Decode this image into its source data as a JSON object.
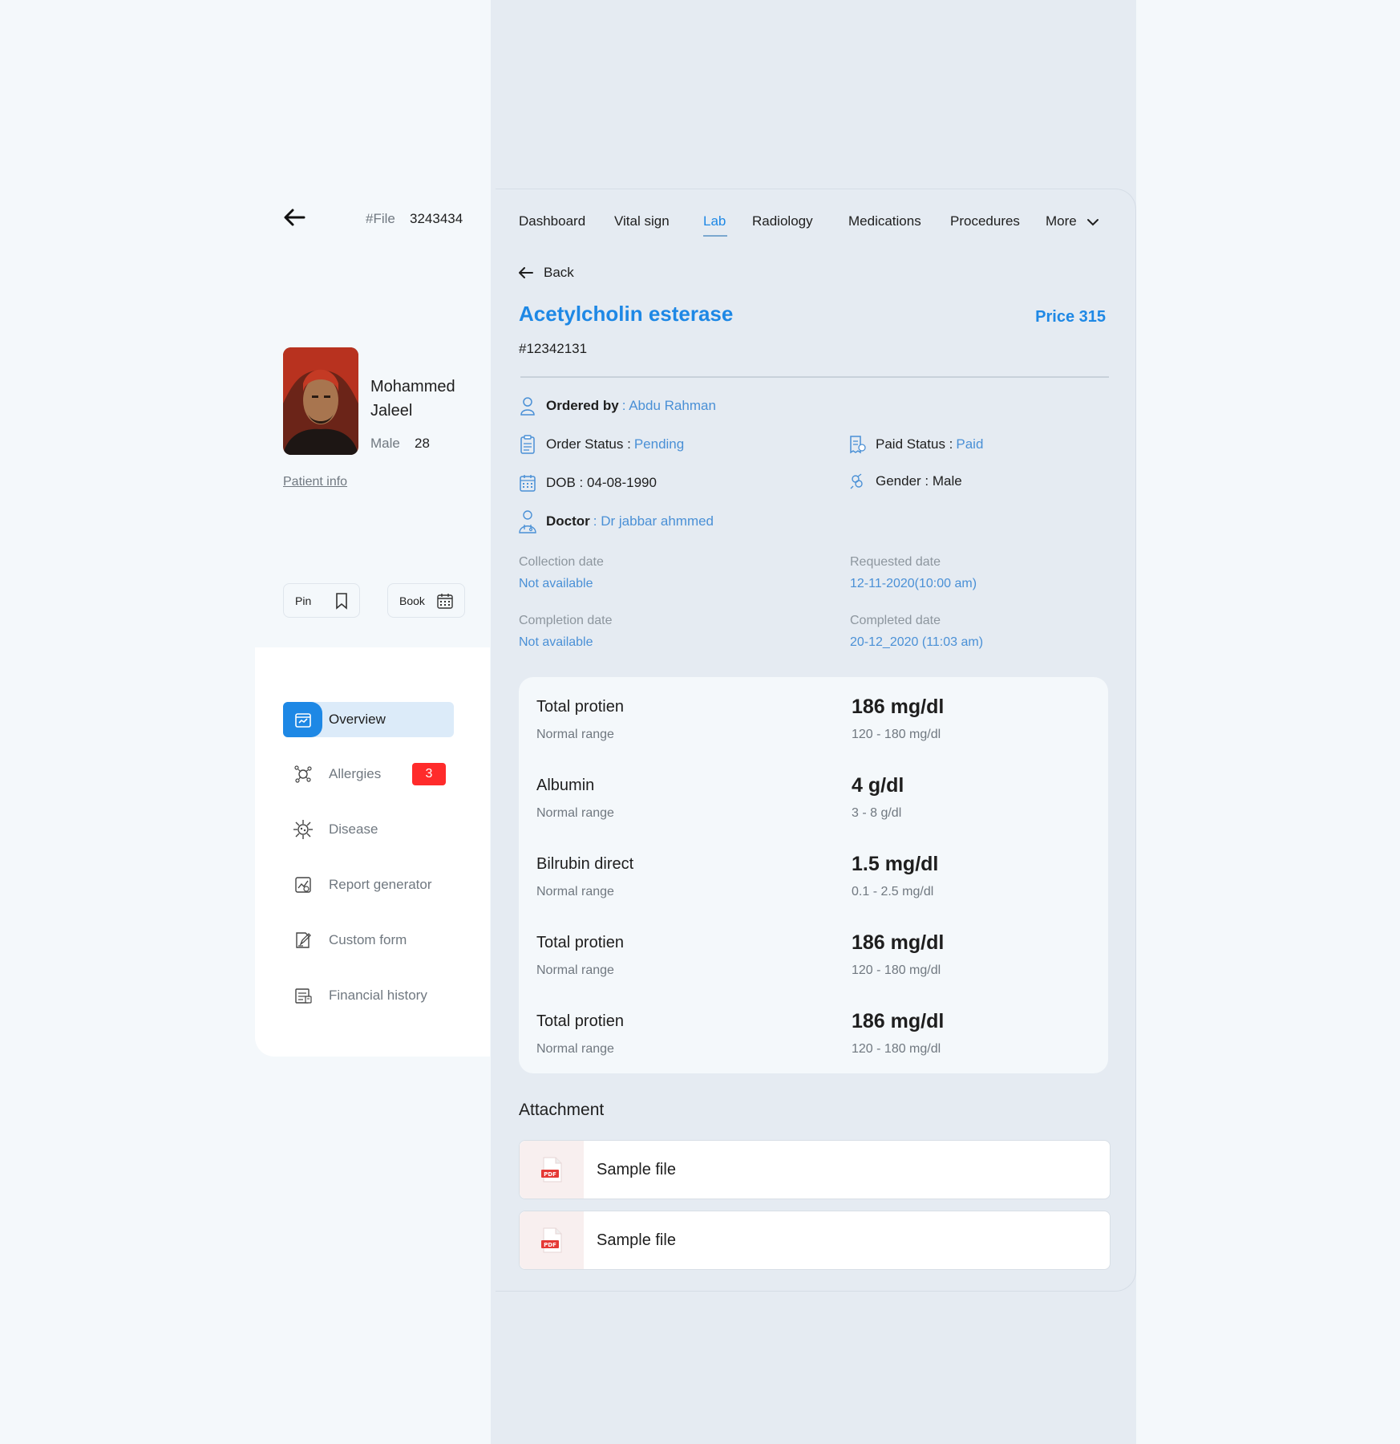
{
  "header": {
    "file_label": "#File",
    "file_number": "3243434"
  },
  "patient": {
    "name": "Mohammed Jaleel",
    "gender": "Male",
    "age": "28",
    "info_link": "Patient info"
  },
  "actions": {
    "pin_label": "Pin",
    "book_label": "Book"
  },
  "sidebar": {
    "items": [
      {
        "label": "Overview",
        "icon": "overview-icon",
        "active": true
      },
      {
        "label": "Allergies",
        "icon": "allergies-icon",
        "badge": "3"
      },
      {
        "label": "Disease",
        "icon": "virus-icon"
      },
      {
        "label": "Report generator",
        "icon": "report-chart-icon"
      },
      {
        "label": "Custom form",
        "icon": "edit-form-icon"
      },
      {
        "label": "Financial history",
        "icon": "financial-icon"
      }
    ]
  },
  "tabs": [
    {
      "label": "Dashboard"
    },
    {
      "label": "Vital sign"
    },
    {
      "label": "Lab",
      "active": true
    },
    {
      "label": "Radiology"
    },
    {
      "label": "Medications"
    },
    {
      "label": "Procedures"
    },
    {
      "label": "More"
    }
  ],
  "lab": {
    "back_label": "Back",
    "title": "Acetylcholin esterase",
    "price": "Price 315",
    "id": "#12342131",
    "ordered_by_label": "Ordered by",
    "ordered_by_value": ": Abdu Rahman",
    "order_status_label": "Order Status :",
    "order_status_value": "Pending",
    "paid_status_label": "Paid Status :",
    "paid_status_value": "Paid",
    "dob": "DOB : 04-08-1990",
    "gender": "Gender : Male",
    "doctor_label": "Doctor",
    "doctor_value": ": Dr jabbar ahmmed",
    "collection_date_label": "Collection date",
    "collection_date_value": "Not available",
    "requested_date_label": "Requested date",
    "requested_date_value": "12-11-2020(10:00 am)",
    "completion_date_label": "Completion date",
    "completion_date_value": "Not available",
    "completed_date_label": "Completed date",
    "completed_date_value": "20-12_2020 (11:03 am)"
  },
  "results": [
    {
      "name": "Total protien",
      "range_label": "Normal range",
      "value": "186 mg/dl",
      "range": "120 - 180 mg/dl"
    },
    {
      "name": "Albumin",
      "range_label": "Normal range",
      "value": "4 g/dl",
      "range": "3 - 8 g/dl"
    },
    {
      "name": "Bilrubin direct",
      "range_label": "Normal range",
      "value": "1.5 mg/dl",
      "range": "0.1 - 2.5 mg/dl"
    },
    {
      "name": "Total protien",
      "range_label": "Normal range",
      "value": "186 mg/dl",
      "range": "120 - 180 mg/dl"
    },
    {
      "name": "Total protien",
      "range_label": "Normal range",
      "value": "186 mg/dl",
      "range": "120 - 180 mg/dl"
    }
  ],
  "attachments": {
    "title": "Attachment",
    "files": [
      {
        "name": "Sample file"
      },
      {
        "name": "Sample file"
      }
    ]
  },
  "colors": {
    "accent": "#1e88e5",
    "link": "#4a90d6",
    "badge": "#ff2b2b",
    "main_bg": "#e5ebf2",
    "page_bg": "#f4f8fb"
  }
}
